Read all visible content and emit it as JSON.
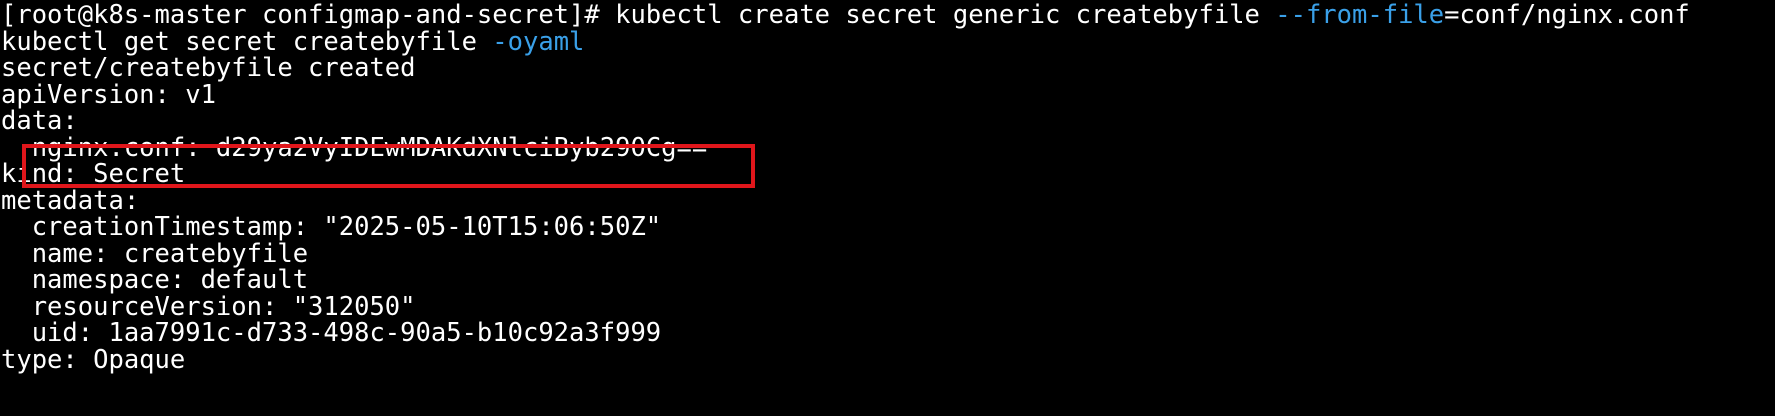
{
  "colors": {
    "background": "#000000",
    "text": "#ffffff",
    "flag": "#3aa0e8",
    "highlight_border": "#e0161b"
  },
  "terminal": {
    "prompt": "[root@k8s-master configmap-and-secret]# ",
    "command1": {
      "head": "kubectl create secret generic createbyfile ",
      "flag": "--from-file",
      "tail": "=conf/nginx.conf"
    },
    "command2": {
      "head": "kubectl get secret createbyfile ",
      "flag": "-oyaml"
    },
    "output": [
      "secret/createbyfile created",
      "apiVersion: v1",
      "data:",
      "  nginx.conf: d29ya2VyIDEwMDAKdXNlciByb290Cg==",
      "kind: Secret",
      "metadata:",
      "  creationTimestamp: \"2025-05-10T15:06:50Z\"",
      "  name: createbyfile",
      "  namespace: default",
      "  resourceVersion: \"312050\"",
      "  uid: 1aa7991c-d733-498c-90a5-b10c92a3f999",
      "type: Opaque"
    ]
  }
}
